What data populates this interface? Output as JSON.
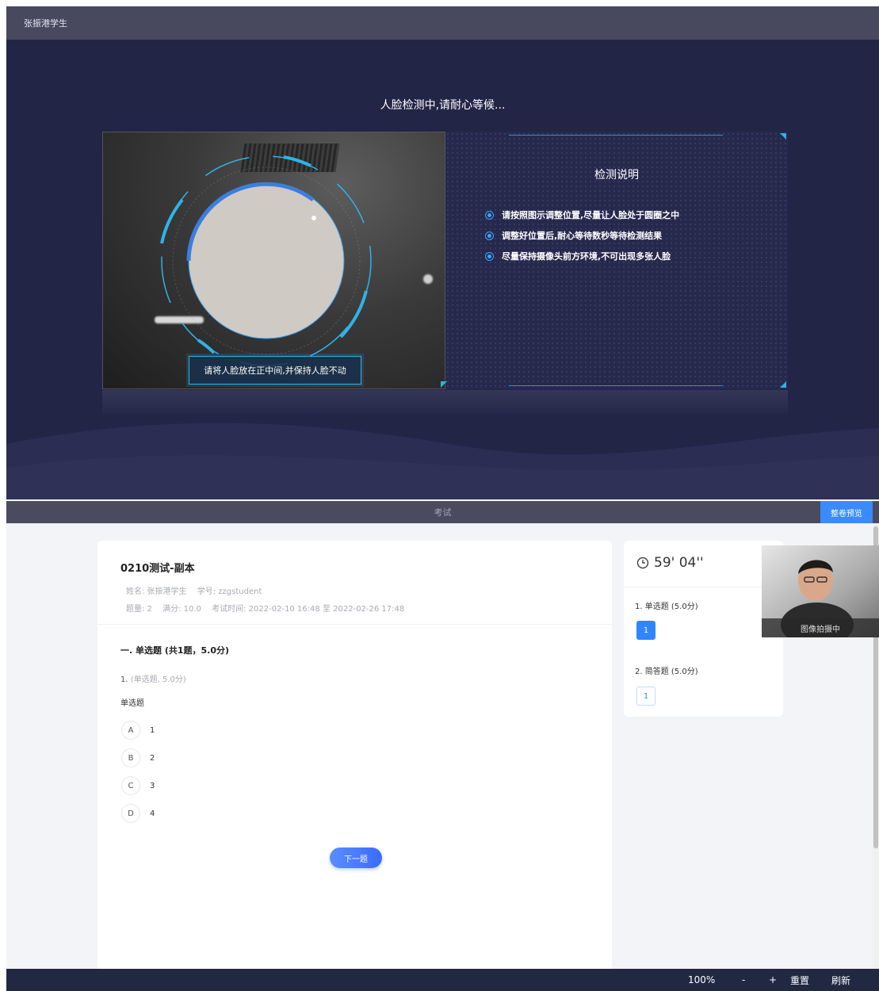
{
  "face_check": {
    "topbar_user": "张振港学生",
    "status_title": "人脸检测中,请耐心等候...",
    "camera_hint": "请将人脸放在正中间,并保持人脸不动",
    "instructions_title": "检测说明",
    "instructions": [
      "请按照图示调整位置,尽量让人脸处于圆圈之中",
      "调整好位置后,耐心等待数秒等待检测结果",
      "尽量保持摄像头前方环境,不可出现多张人脸"
    ]
  },
  "exam": {
    "topbar_title": "考试",
    "preview_button": "整卷预览",
    "paper_title": "0210测试-副本",
    "meta_line1": [
      "姓名: 张振港学生",
      "学号: zzgstudent"
    ],
    "meta_line2": [
      "题量: 2",
      "满分: 10.0",
      "考试时间: 2022-02-10 16:48 至 2022-02-26 17:48"
    ],
    "section_title": "一. 单选题 (共1题，5.0分)",
    "question_number": "1.",
    "question_type": "(单选题, 5.0分)",
    "question_stem": "单选题",
    "options": [
      {
        "letter": "A",
        "text": "1"
      },
      {
        "letter": "B",
        "text": "2"
      },
      {
        "letter": "C",
        "text": "3"
      },
      {
        "letter": "D",
        "text": "4"
      }
    ],
    "next_button": "下一题",
    "timer": "59' 04''",
    "sections": [
      {
        "label": "1. 单选题 (5.0分)",
        "questions": [
          "1"
        ]
      },
      {
        "label": "2. 简答题 (5.0分)",
        "questions": [
          "1"
        ]
      }
    ],
    "webcam_label": "图像拍摄中"
  },
  "statusbar": {
    "zoom": "100%",
    "zoom_out": "-",
    "zoom_in": "+",
    "reset": "重置",
    "refresh": "刷新"
  },
  "colors": {
    "face_bg": "#232546",
    "accent_blue": "#2f86ff",
    "ring_blue": "#2fb3e8",
    "statusbar_bg": "#212842"
  }
}
